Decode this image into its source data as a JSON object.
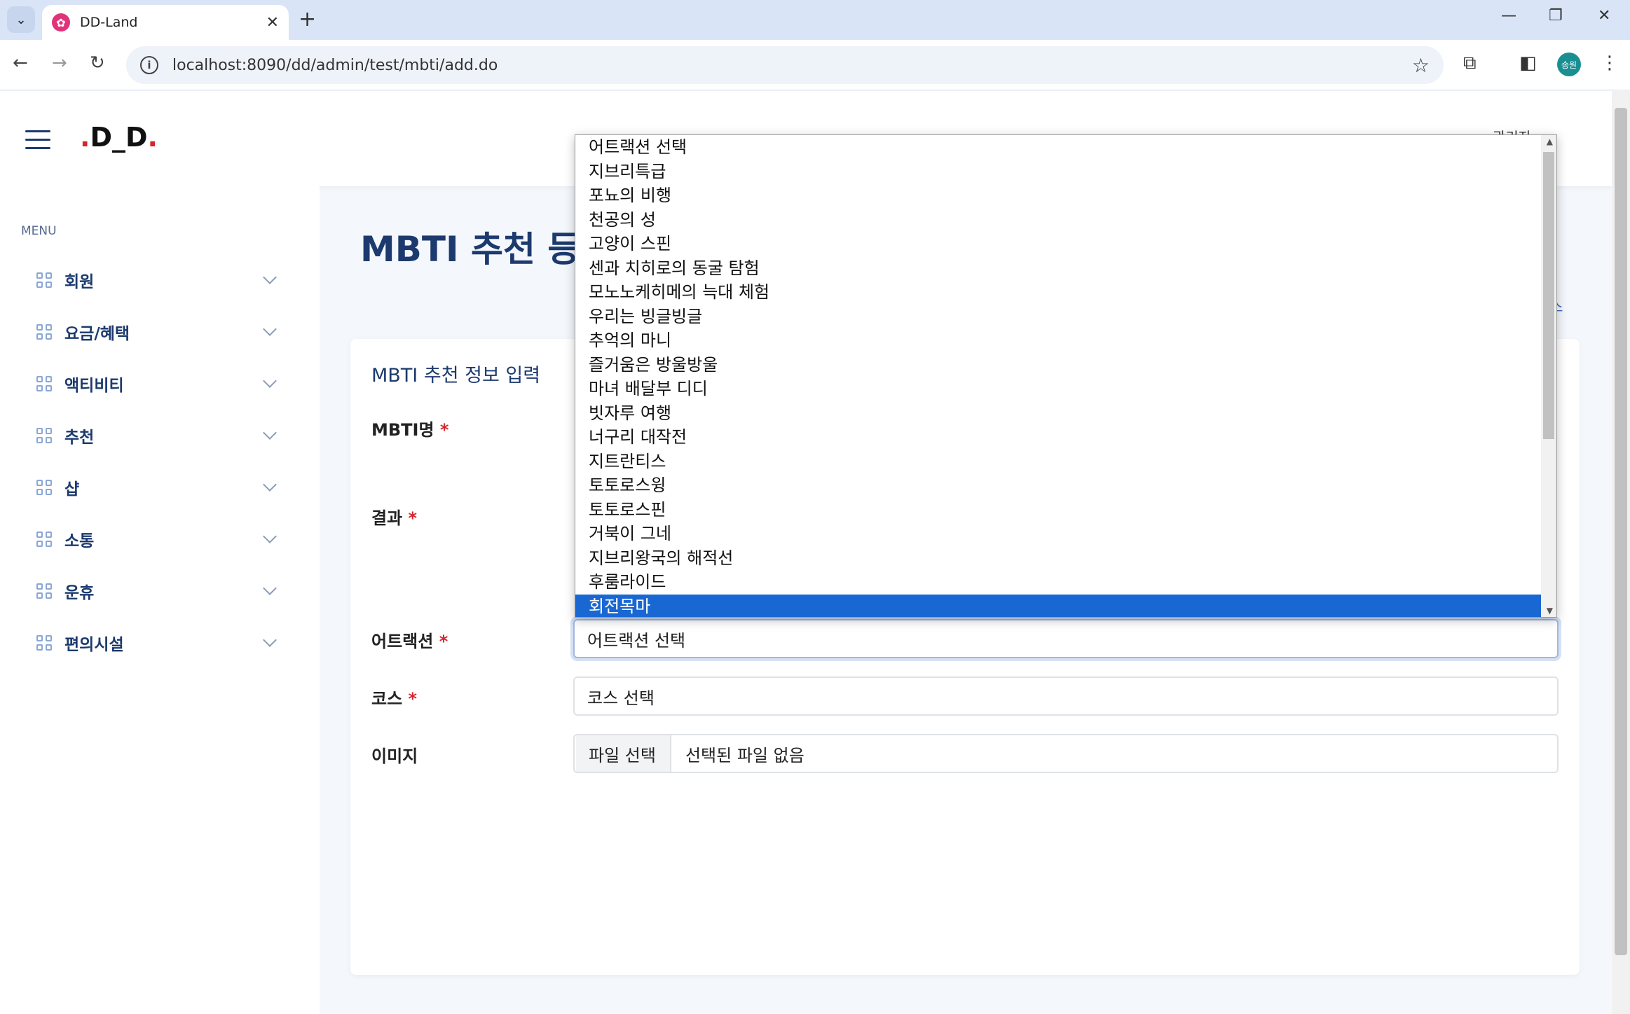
{
  "browser": {
    "tab_title": "DD-Land",
    "url": "localhost:8090/dd/admin/test/mbti/add.do",
    "profile_initials": "송원"
  },
  "header": {
    "logo": "D_D",
    "user": "관리자"
  },
  "sidebar": {
    "menu_label": "MENU",
    "items": [
      {
        "label": "회원"
      },
      {
        "label": "요금/혜택"
      },
      {
        "label": "액티비티"
      },
      {
        "label": "추천"
      },
      {
        "label": "샵"
      },
      {
        "label": "소통"
      },
      {
        "label": "운휴"
      },
      {
        "label": "편의시설"
      }
    ]
  },
  "page": {
    "title": "MBTI 추천 등록",
    "breadcrumb_tail": "스"
  },
  "form": {
    "card_title": "MBTI 추천 정보 입력",
    "mbti_label": "MBTI명",
    "result_label": "결과",
    "attraction_label": "어트랙션",
    "course_label": "코스",
    "image_label": "이미지",
    "required_mark": "*",
    "attraction_value": "어트랙션 선택",
    "course_value": "코스 선택",
    "file_button": "파일 선택",
    "file_name": "선택된 파일 없음"
  },
  "dropdown": {
    "options": [
      "어트랙션 선택",
      "지브리특급",
      "포뇨의 비행",
      "천공의 성",
      "고양이 스핀",
      "센과 치히로의 동굴 탐험",
      "모노노케히메의 늑대 체험",
      "우리는 빙글빙글",
      "추억의 마니",
      "즐거움은 방울방울",
      "마녀 배달부 디디",
      "빗자루 여행",
      "너구리 대작전",
      "지트란티스",
      "토토로스윙",
      "토토로스핀",
      "거북이 그네",
      "지브리왕국의 해적선",
      "후룸라이드",
      "회전목마"
    ],
    "selected_index": 19
  }
}
